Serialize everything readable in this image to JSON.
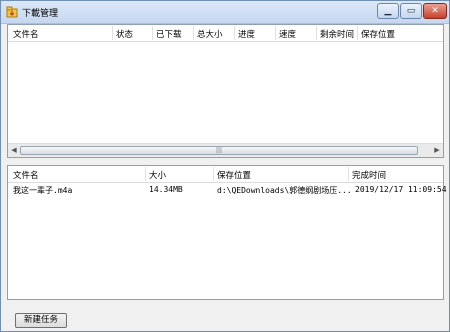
{
  "window": {
    "title": "下載管理"
  },
  "top_grid": {
    "columns": [
      "文件名",
      "状态",
      "已下载",
      "总大小",
      "进度",
      "速度",
      "剩余时间",
      "保存位置"
    ],
    "rows": []
  },
  "bottom_grid": {
    "columns": [
      "文件名",
      "大小",
      "保存位置",
      "完成时间"
    ],
    "rows": [
      {
        "name": "我这一辈子.m4a",
        "size": "14.34MB",
        "path": "d:\\QEDownloads\\郭德纲剧场压...",
        "finished": "2019/12/17 11:09:54"
      }
    ]
  },
  "buttons": {
    "new_task": "新建任务"
  }
}
